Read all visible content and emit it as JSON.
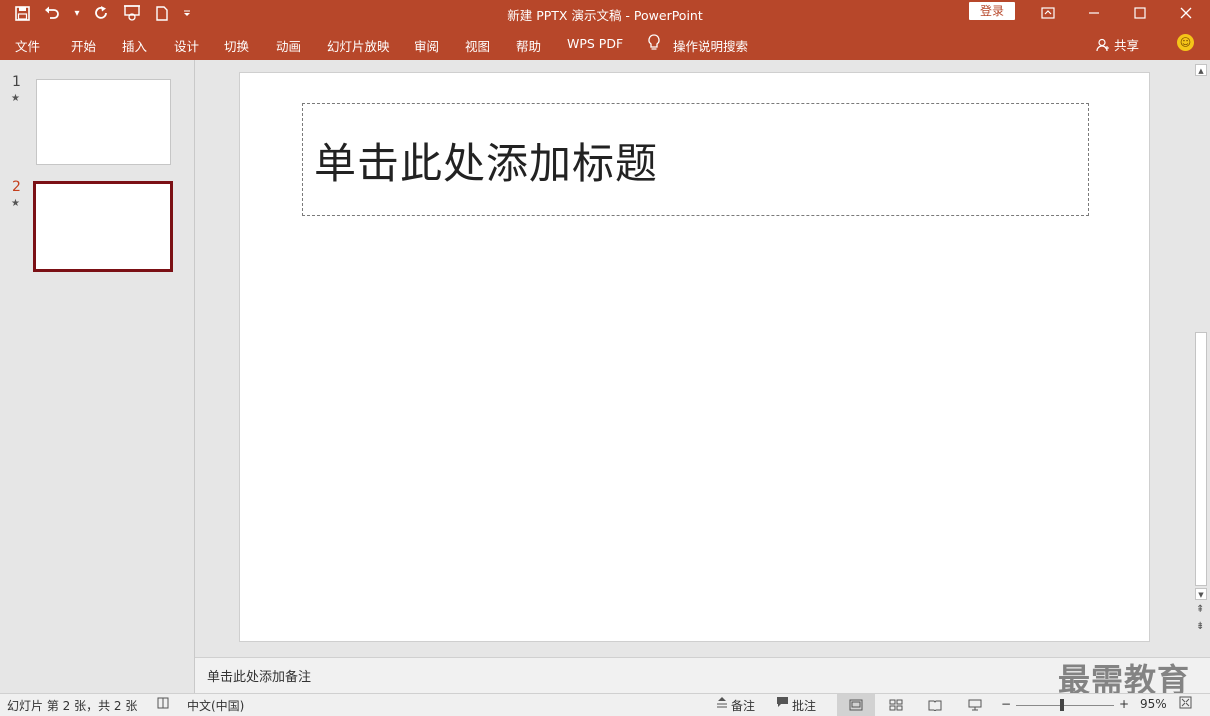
{
  "window": {
    "title": "新建 PPTX 演示文稿  -  PowerPoint",
    "login_label": "登录",
    "controls": [
      "ribbon-display-icon",
      "minimize-icon",
      "maximize-icon",
      "close-icon"
    ]
  },
  "qat": {
    "icons": [
      "save-icon",
      "undo-icon",
      "redo-icon",
      "present-from-start-icon",
      "new-file-icon",
      "customize-qat-icon"
    ]
  },
  "ribbon": {
    "tabs": [
      "文件",
      "开始",
      "插入",
      "设计",
      "切换",
      "动画",
      "幻灯片放映",
      "审阅",
      "视图",
      "帮助",
      "WPS PDF"
    ],
    "tell_me": "操作说明搜索",
    "share": "共享"
  },
  "slides_pane": {
    "items": [
      {
        "number": "1",
        "star": "★",
        "active": false
      },
      {
        "number": "2",
        "star": "★",
        "active": true
      }
    ]
  },
  "slide": {
    "title_placeholder": "单击此处添加标题"
  },
  "notes": {
    "placeholder": "单击此处添加备注"
  },
  "watermark": "最需教育",
  "statusbar": {
    "slide_info": "幻灯片 第 2 张，共 2 张",
    "language": "中文(中国)",
    "notes_label": "备注",
    "comments_label": "批注",
    "zoom_minus": "−",
    "zoom_plus": "+",
    "zoom": "95%"
  },
  "colors": {
    "accent": "#b7472a",
    "active_thumb_border": "#7b1015",
    "active_slide_number": "#c43e1c"
  }
}
